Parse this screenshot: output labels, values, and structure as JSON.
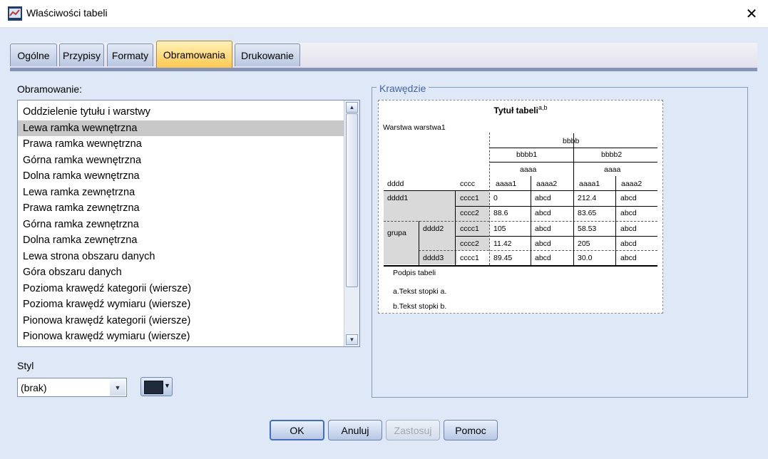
{
  "window": {
    "title": "Właściwości tabeli",
    "close_glyph": "✕"
  },
  "tabs": [
    {
      "label": "Ogólne"
    },
    {
      "label": "Przypisy"
    },
    {
      "label": "Formaty"
    },
    {
      "label": "Obramowania",
      "active": true
    },
    {
      "label": "Drukowanie"
    }
  ],
  "left": {
    "border_label": "Obramowanie:",
    "items": [
      "Oddzielenie tytułu i warstwy",
      "Lewa ramka wewnętrzna",
      "Prawa ramka wewnętrzna",
      "Górna ramka wewnętrzna",
      "Dolna ramka wewnętrzna",
      "Lewa ramka zewnętrzna",
      "Prawa ramka zewnętrzna",
      "Górna ramka zewnętrzna",
      "Dolna ramka zewnętrzna",
      "Lewa strona obszaru danych",
      "Góra obszaru danych",
      "Pozioma krawędź kategorii (wiersze)",
      "Pozioma krawędź wymiaru (wiersze)",
      "Pionowa krawędź kategorii (wiersze)",
      "Pionowa krawędź wymiaru (wiersze)"
    ],
    "selected_index": 1,
    "style_label": "Styl",
    "style_value": "(brak)",
    "color_value": "#1f2a3a"
  },
  "preview": {
    "group_title": "Krawędzie",
    "table_title": "Tytuł tabeli",
    "title_sup": "a,b",
    "layer": "Warstwa warstwa1",
    "col_top": "bbbb",
    "col_b1": "bbbb1",
    "col_b2": "bbbb2",
    "col_a_1": "aaaa",
    "col_a_2": "aaaa",
    "row_dim": "dddd",
    "row_c": "cccc",
    "col_leaves": [
      "aaaa1",
      "aaaa2",
      "aaaa1",
      "aaaa2"
    ],
    "group": "grupa",
    "rows": [
      {
        "d": "dddd1",
        "c": "cccc1",
        "v": [
          "0",
          "abcd",
          "212.4",
          "abcd"
        ]
      },
      {
        "d": "",
        "c": "cccc2",
        "v": [
          "88.6",
          "abcd",
          "83.65",
          "abcd"
        ]
      },
      {
        "d": "dddd2",
        "c": "cccc1",
        "v": [
          "105",
          "abcd",
          "58.53",
          "abcd"
        ]
      },
      {
        "d": "",
        "c": "cccc2",
        "v": [
          "11.42",
          "abcd",
          "205",
          "abcd"
        ]
      },
      {
        "d": "dddd3",
        "c": "cccc1",
        "v": [
          "89.45",
          "abcd",
          "30.0",
          "abcd"
        ]
      }
    ],
    "caption": "Podpis tabeli",
    "footnote_a": "a.Tekst stopki a.",
    "footnote_b": "b.Tekst stopki b."
  },
  "buttons": {
    "ok": "OK",
    "cancel": "Anuluj",
    "apply": "Zastosuj",
    "help": "Pomoc"
  }
}
